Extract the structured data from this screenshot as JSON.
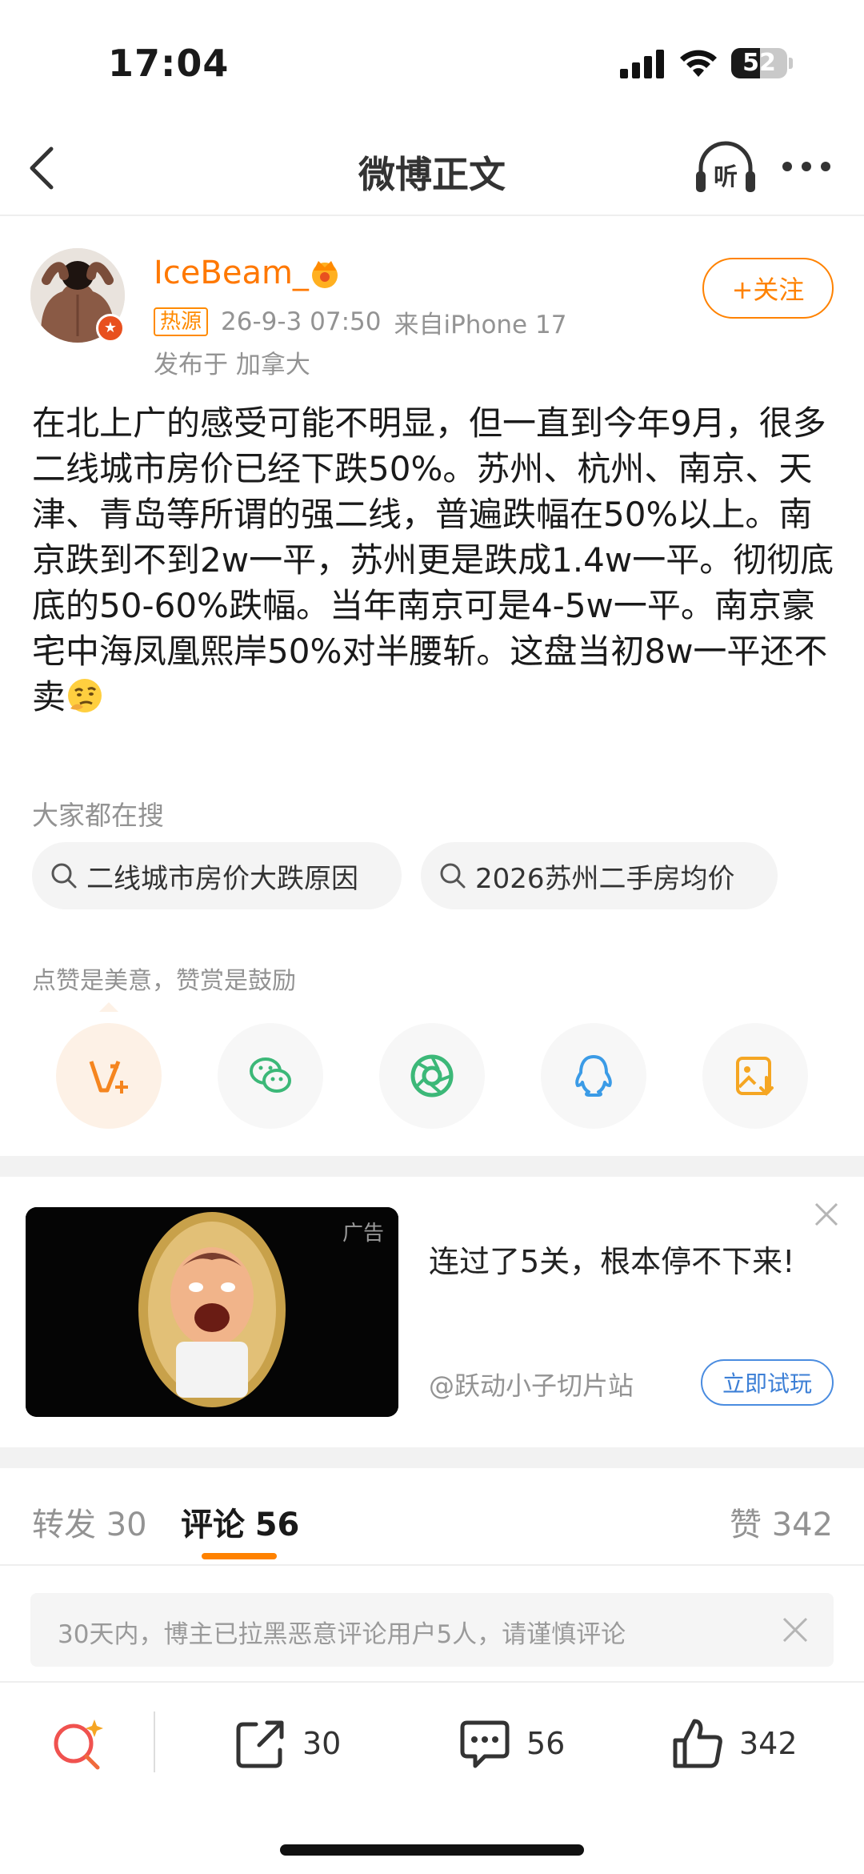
{
  "status_bar": {
    "time": "17:04",
    "battery": "52",
    "battery_level": 0.52
  },
  "navbar": {
    "title": "微博正文",
    "listen_label": "听"
  },
  "author": {
    "name": "IceBeam_",
    "hot_tag": "热源",
    "posted_at": "26-9-3 07:50",
    "device": "来自iPhone 17",
    "location": "发布于 加拿大",
    "follow_label": "+关注"
  },
  "post": {
    "text": "在北上广的感受可能不明显，但一直到今年9月，很多二线城市房价已经下跌50%。苏州、杭州、南京、天津、青岛等所谓的强二线，普遍跌幅在50%以上。南京跌到不到2w一平，苏州更是跌成1.4w一平。彻彻底底的50-60%跌幅。当年南京可是4-5w一平。南京豪宅中海凤凰熙岸50%对半腰斩。这盘当初8w一平还不卖"
  },
  "search": {
    "label": "大家都在搜",
    "chips": [
      "二线城市房价大跌原因",
      "2026苏州二手房均价"
    ]
  },
  "reward": {
    "hint": "点赞是美意，赞赏是鼓励",
    "actions": [
      "v-plus-icon",
      "wechat-icon",
      "moments-icon",
      "qq-icon",
      "save-image-icon"
    ]
  },
  "ad": {
    "tag": "广告",
    "title": "连过了5关，根本停不下来!",
    "source": "@跃动小子切片站",
    "cta": "立即试玩"
  },
  "tabs": {
    "repost": {
      "label": "转发",
      "count": "30"
    },
    "comment": {
      "label": "评论",
      "count": "56"
    },
    "like": {
      "label": "赞",
      "count": "342"
    }
  },
  "notice": {
    "text": "30天内，博主已拉黑恶意评论用户5人，请谨慎评论"
  },
  "bottom_bar": {
    "repost": "30",
    "comment": "56",
    "like": "342"
  },
  "colors": {
    "accent": "#ff8200",
    "username": "#ff7800",
    "link_blue": "#3c7fd6"
  }
}
